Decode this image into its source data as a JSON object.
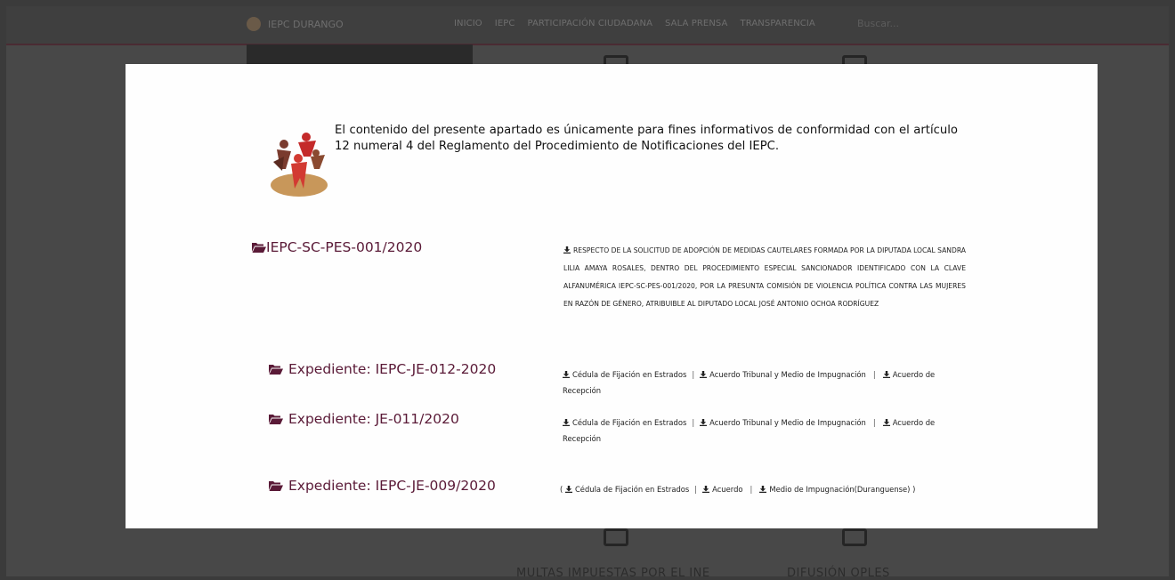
{
  "navbar": {
    "brand": "IEPC DURANGO",
    "items": [
      "INICIO",
      "IEPC",
      "PARTICIPACIÓN CIUDADANA",
      "SALA PRENSA",
      "TRANSPARENCIA"
    ],
    "search_placeholder": "Buscar..."
  },
  "background": {
    "captions": [
      "MULTAS IMPUESTAS POR EL INE",
      "DIFUSIÓN OPLES"
    ]
  },
  "modal": {
    "notice": "El contenido del presente apartado es únicamente para fines informativos de conformidad con el artículo 12 numeral 4 del Reglamento del Procedimiento de Notificaciones del IEPC.",
    "cases": [
      {
        "title": "IEPC-SC-PES-001/2020",
        "description": "RESPECTO DE LA SOLICITUD DE ADOPCIÓN DE MEDIDAS CAUTELARES FORMADA POR LA DIPUTADA LOCAL SANDRA LILIA AMAYA ROSALES, DENTRO DEL PROCEDIMIENTO ESPECIAL SANCIONADOR IDENTIFICADO CON LA CLAVE ALFANUMÉRICA IEPC-SC-PES-001/2020, POR LA PRESUNTA COMISIÓN DE VIOLENCIA POLÍTICA CONTRA LAS MUJERES EN RAZÓN DE GÉNERO, ATRIBUIBLE AL DIPUTADO LOCAL JOSÉ ANTONIO OCHOA RODRÍGUEZ"
      },
      {
        "title": "Expediente: IEPC-JE-012-2020",
        "links": [
          "Cédula de Fijación en Estrados",
          "Acuerdo Tribunal y Medio de Impugnación",
          "Acuerdo de Recepción"
        ]
      },
      {
        "title": "Expediente: JE-011/2020",
        "links": [
          "Cédula de Fijación en Estrados",
          "Acuerdo Tribunal y Medio de Impugnación",
          "Acuerdo de Recepción"
        ]
      },
      {
        "title": "Expediente: IEPC-JE-009/2020",
        "links": [
          "Cédula de Fijación en Estrados",
          "Acuerdo",
          "Medio de Impugnación(Duranguense)"
        ],
        "open": "(",
        "close": ")"
      }
    ]
  },
  "colors": {
    "accent": "#5a1a37",
    "overlay": "#3b3b3b",
    "modal_bg": "#fefefe"
  }
}
